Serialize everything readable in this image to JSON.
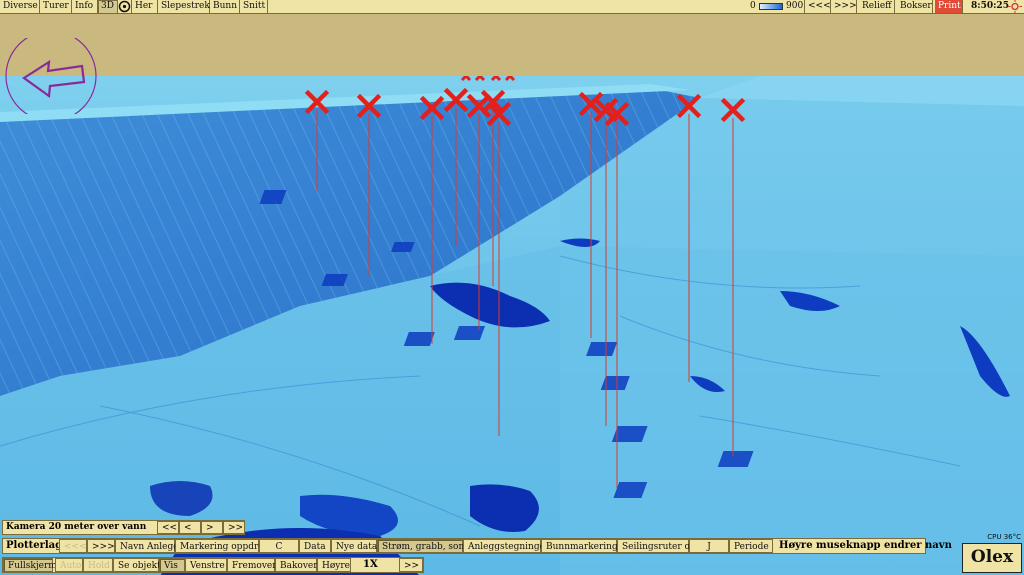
{
  "toolbar": {
    "left": [
      "Diverse",
      "Turer",
      "Info",
      "3D",
      "Her",
      "Slepestrek",
      "Bunn",
      "Snitt"
    ],
    "depth_min": "0",
    "depth_max": "900",
    "back": "<<<",
    "forward": ">>>",
    "relief": "Relieff",
    "boxes": "Bokser",
    "print": "Print",
    "time": "8:50:25"
  },
  "camera": {
    "label": "Kamera 20 meter over vann",
    "buttons": [
      "<<",
      "<",
      ">",
      ">>"
    ]
  },
  "plotter": {
    "label": "Plotterlag",
    "items": [
      "<<<",
      ">>>",
      "Navn Anlegg",
      "Markering oppdrett",
      "C",
      "Data",
      "Nye data",
      "Strøm, grabb, sonde",
      "Anleggstegninger",
      "Bunnmarkeringer",
      "Seilingsruter o.l.",
      "J",
      "Periode"
    ],
    "hint": "Høyre museknapp endrer navn"
  },
  "nav": {
    "items": [
      "Fullskjerm",
      "Auto",
      "Hold",
      "Se objekt",
      "Vis",
      "Venstre",
      "Fremover",
      "Bakover",
      "Høyre"
    ],
    "speed": "1X",
    "speed_next": ">>"
  },
  "cpu": "CPU 36°C",
  "brand": "Olex",
  "colors": {
    "seabed": "#5fb7e6",
    "deep": "#0b2fb0",
    "marker": "#e3201b",
    "panel": "#efe3a5"
  }
}
